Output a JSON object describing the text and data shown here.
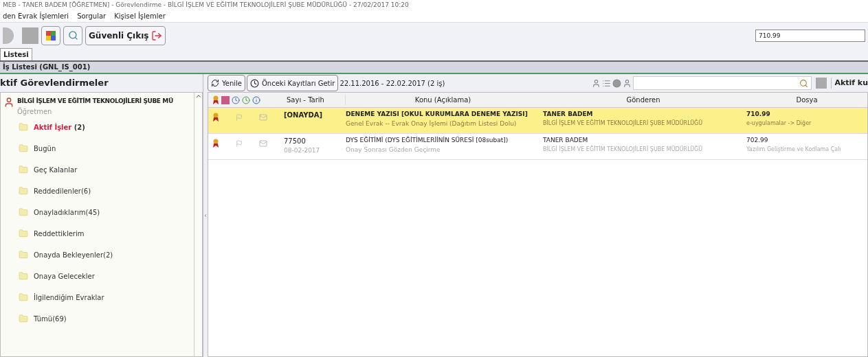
{
  "window": {
    "title": "MEB - TANER BADEM [ÖĞRETMEN] - Görevlendirme - BİLGİ İŞLEM VE EĞİTİM TEKNOLOJİLERİ ŞUBE MÜDÜRLÜĞÜ - 27/02/2017 10:20"
  },
  "menu": [
    "den Evrak İşlemleri",
    "Sorgular",
    "Kişisel İşlemler"
  ],
  "toolbar": {
    "exit_button": "Güvenli Çıkış",
    "search_value": "710.99"
  },
  "tabs": [
    {
      "label": "Listesi",
      "selected": true
    }
  ],
  "panel_title": "İş Listesi (GNL_IS_001)",
  "sidebar": {
    "title": "ktif Görevlendirmeler",
    "unit": "BİLGİ İŞLEM VE EĞİTİM TEKNOLOJİLERİ ŞUBE MÜ",
    "role": "Öğretmen",
    "items": [
      {
        "label": "Aktif İşler",
        "count": " (2)",
        "selected": true
      },
      {
        "label": "Bugün",
        "selected": false
      },
      {
        "label": "Geç Kalanlar",
        "selected": false
      },
      {
        "label": "Reddedilenler(6)",
        "selected": false
      },
      {
        "label": "Onayladıklarım(45)",
        "selected": false
      },
      {
        "label": "Reddettiklerim",
        "selected": false
      },
      {
        "label": "Onayda Bekleyenler(2)",
        "selected": false
      },
      {
        "label": "Onaya Gelecekler",
        "selected": false
      },
      {
        "label": "İlgilendiğim Evraklar",
        "selected": false
      },
      {
        "label": "Tümü(69)",
        "selected": false
      }
    ]
  },
  "list_toolbar": {
    "refresh": "Yenile",
    "previous": "Önceki Kayıtları Getir",
    "range": "22.11.2016 - 22.02.2017 (2 iş)",
    "filter": "Aktif ku"
  },
  "table": {
    "columns": [
      "Sayı - Tarih",
      "Konu (Açıklama)",
      "Gönderen",
      "Dosya"
    ],
    "rows": [
      {
        "selected": true,
        "number": "[ONAYDA]",
        "subject": "DENEME YAZISI   [OKUL KURUMLARA DENEME YAZISI]",
        "subject_note": "Genel Evrak -- Evrak Onay İşlemi (Dağıtım Listesi Dolu)",
        "sender": "TANER BADEM",
        "sender_unit": "BİLGİ İŞLEM VE EĞİTİM TEKNOLOJİLERİ ŞUBE MÜDÜRLÜĞÜ",
        "file": "710.99",
        "file_note": "e-uygulamalar -> Diğer"
      },
      {
        "selected": false,
        "number": "77500",
        "date": "08-02-2017",
        "subject": "DYS EĞİTİMİ   (DYS EĞİTİMLERİİNİN SÜRESİ [08subat])",
        "subject_note": "Onay Sonrası Gözden Geçirme",
        "sender": "TANER BADEM",
        "sender_unit": "BİLGİ İŞLEM VE EĞİTİM TEKNOLOJİLERİ ŞUBE MÜDÜRLÜĞÜ",
        "file": "702.99",
        "file_note": "Yazılım Geliştirme ve Kodlama Çalı"
      }
    ]
  }
}
